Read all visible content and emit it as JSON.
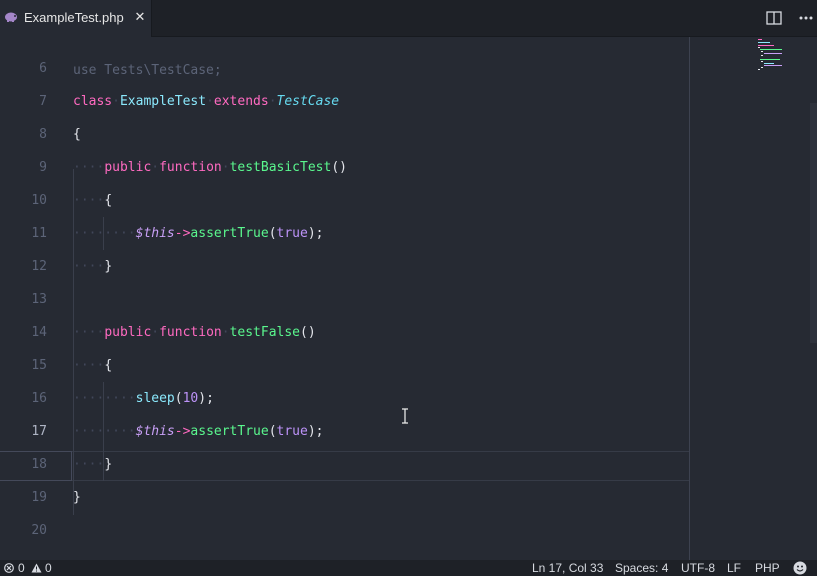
{
  "tab": {
    "filename": "ExampleTest.php",
    "file_icon": "php-elephant-icon",
    "close_icon": "close-icon"
  },
  "toolbar": {
    "split_icon": "split-editor-icon",
    "more_icon": "more-actions-icon"
  },
  "editor": {
    "partial_top_line": "use Tests\\TestCase;",
    "lines": [
      {
        "num": "6",
        "text": ""
      },
      {
        "num": "7",
        "tokens": [
          [
            "kw",
            "class"
          ],
          [
            "dot",
            "·"
          ],
          [
            "cls",
            "ExampleTest"
          ],
          [
            "dot",
            "·"
          ],
          [
            "ext",
            "extends"
          ],
          [
            "dot",
            "·"
          ],
          [
            "it",
            "TestCase"
          ]
        ]
      },
      {
        "num": "8",
        "text": "{"
      },
      {
        "num": "9",
        "tokens": [
          [
            "dot",
            "····"
          ],
          [
            "kw",
            "public"
          ],
          [
            "dot",
            "·"
          ],
          [
            "kw",
            "function"
          ],
          [
            "dot",
            "·"
          ],
          [
            "fn",
            "testBasicTest"
          ],
          [
            "plain",
            "()"
          ]
        ]
      },
      {
        "num": "10",
        "tokens": [
          [
            "dot",
            "····"
          ],
          [
            "plain",
            "{"
          ]
        ]
      },
      {
        "num": "11",
        "tokens": [
          [
            "dot",
            "········"
          ],
          [
            "var",
            "$this"
          ],
          [
            "arrow",
            "->"
          ],
          [
            "fn",
            "assertTrue"
          ],
          [
            "plain",
            "("
          ],
          [
            "bool",
            "true"
          ],
          [
            "plain",
            ");"
          ]
        ]
      },
      {
        "num": "12",
        "tokens": [
          [
            "dot",
            "····"
          ],
          [
            "plain",
            "}"
          ]
        ]
      },
      {
        "num": "13",
        "text": ""
      },
      {
        "num": "14",
        "tokens": [
          [
            "dot",
            "····"
          ],
          [
            "kw",
            "public"
          ],
          [
            "dot",
            "·"
          ],
          [
            "kw",
            "function"
          ],
          [
            "dot",
            "·"
          ],
          [
            "fn",
            "testFalse"
          ],
          [
            "plain",
            "()"
          ]
        ]
      },
      {
        "num": "15",
        "tokens": [
          [
            "dot",
            "····"
          ],
          [
            "plain",
            "{"
          ]
        ]
      },
      {
        "num": "16",
        "tokens": [
          [
            "dot",
            "········"
          ],
          [
            "cls",
            "sleep"
          ],
          [
            "plain",
            "("
          ],
          [
            "num",
            "10"
          ],
          [
            "plain",
            ");"
          ]
        ]
      },
      {
        "num": "17",
        "tokens": [
          [
            "dot",
            "········"
          ],
          [
            "var",
            "$this"
          ],
          [
            "arrow",
            "->"
          ],
          [
            "fn",
            "assertTrue"
          ],
          [
            "plain",
            "("
          ],
          [
            "bool",
            "true"
          ],
          [
            "plain",
            ");"
          ]
        ]
      },
      {
        "num": "18",
        "tokens": [
          [
            "dot",
            "····"
          ],
          [
            "plain",
            "}"
          ]
        ]
      },
      {
        "num": "19",
        "text": "}"
      },
      {
        "num": "20",
        "text": ""
      }
    ],
    "active_line": "17"
  },
  "status": {
    "errors": "0",
    "warnings": "0",
    "position": "Ln 17, Col 33",
    "spaces": "Spaces: 4",
    "encoding": "UTF-8",
    "eol": "LF",
    "language": "PHP",
    "feedback_icon": "smiley-icon"
  }
}
